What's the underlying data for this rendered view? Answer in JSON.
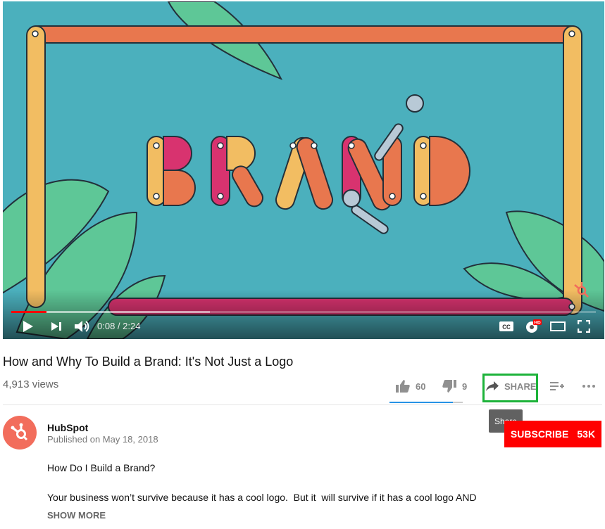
{
  "player": {
    "time_current": "0:08",
    "time_separator": " / ",
    "time_total": "2:24",
    "progress_played_fraction": 0.06,
    "progress_buffered_fraction": 0.34,
    "hd_badge": "HD",
    "captions_label": "CC",
    "brand_artwork_text": "BRAND"
  },
  "video": {
    "title": "How and Why To Build a Brand: It's Not Just a Logo",
    "views": "4,913 views",
    "likes": "60",
    "dislikes": "9",
    "like_fraction": 0.87,
    "share_label": "SHARE",
    "share_tooltip": "Share"
  },
  "channel": {
    "name": "HubSpot",
    "published": "Published on May 18, 2018",
    "subscribe_label": "SUBSCRIBE",
    "subscriber_count": "53K"
  },
  "description": {
    "line1": "How Do I Build a Brand?",
    "line2": "Your business won’t survive because it has a cool logo.  But it  will survive if it has a cool logo AND",
    "show_more": "SHOW MORE"
  },
  "colors": {
    "accent_red": "#ff0000",
    "highlight_green": "#1db33a",
    "player_bg": "#4bb0bd",
    "hubspot_orange": "#f26d5c"
  }
}
